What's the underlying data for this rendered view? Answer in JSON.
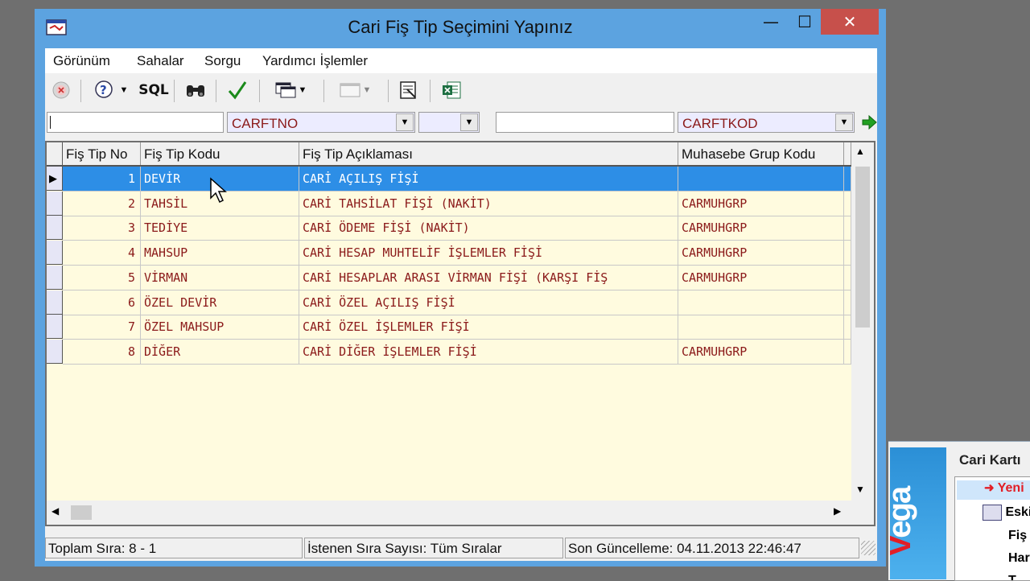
{
  "window": {
    "title": "Cari Fiş Tip Seçimini Yapınız",
    "minimize_glyph": "—",
    "maximize_glyph": "☐",
    "close_glyph": "✕"
  },
  "menu": {
    "items": [
      "Görünüm",
      "Sahalar",
      "Sorgu",
      "Yardımcı İşlemler"
    ]
  },
  "toolbar": {
    "sql_label": "SQL",
    "icons": [
      "cancel-icon",
      "help-query-icon",
      "sql-icon",
      "binoculars-icon",
      "checkmark-icon",
      "window-layout-icon",
      "form-icon",
      "print-preview-icon",
      "excel-icon"
    ]
  },
  "filters": {
    "text1": "",
    "field1": "CARFTNO",
    "operator": "",
    "text2": "",
    "field2": "CARFTKOD"
  },
  "grid": {
    "columns": [
      "Fiş Tip No",
      "Fiş Tip Kodu",
      "Fiş Tip Açıklaması",
      "Muhasebe Grup Kodu"
    ],
    "rows": [
      {
        "no": "1",
        "kod": "DEVİR",
        "aciklama": "CARİ AÇILIŞ FİŞİ",
        "grup": ""
      },
      {
        "no": "2",
        "kod": "TAHSİL",
        "aciklama": "CARİ TAHSİLAT FİŞİ (NAKİT)",
        "grup": "CARMUHGRP"
      },
      {
        "no": "3",
        "kod": "TEDİYE",
        "aciklama": "CARİ ÖDEME FİŞİ (NAKİT)",
        "grup": "CARMUHGRP"
      },
      {
        "no": "4",
        "kod": "MAHSUP",
        "aciklama": "CARİ HESAP MUHTELİF İŞLEMLER FİŞİ",
        "grup": "CARMUHGRP"
      },
      {
        "no": "5",
        "kod": "VİRMAN",
        "aciklama": "CARİ HESAPLAR ARASI VİRMAN FİŞİ (KARŞI FİŞ",
        "grup": "CARMUHGRP"
      },
      {
        "no": "6",
        "kod": "ÖZEL DEVİR",
        "aciklama": "CARİ ÖZEL AÇILIŞ FİŞİ",
        "grup": ""
      },
      {
        "no": "7",
        "kod": "ÖZEL MAHSUP",
        "aciklama": "CARİ ÖZEL İŞLEMLER FİŞİ",
        "grup": ""
      },
      {
        "no": "8",
        "kod": "DİĞER",
        "aciklama": "CARİ DİĞER İŞLEMLER FİŞİ",
        "grup": "CARMUHGRP"
      }
    ],
    "selected_row": 1
  },
  "status": {
    "total": "Toplam Sıra: 8 - 1",
    "requested": "İstenen Sıra Sayısı: Tüm Sıralar",
    "updated": "Son Güncelleme: 04.11.2013 22:46:47"
  },
  "background_app": {
    "panel_title": "Cari Kartı",
    "logo_text": "Vega",
    "items": [
      "Yeni",
      "Eski",
      "Fiş",
      "Har",
      "T"
    ]
  },
  "colors": {
    "accent": "#2d8ee6",
    "grid_bg": "#fffbdf",
    "cell_text": "#8b1a1a",
    "titlebar": "#5ca3e0",
    "close": "#c7504b"
  }
}
